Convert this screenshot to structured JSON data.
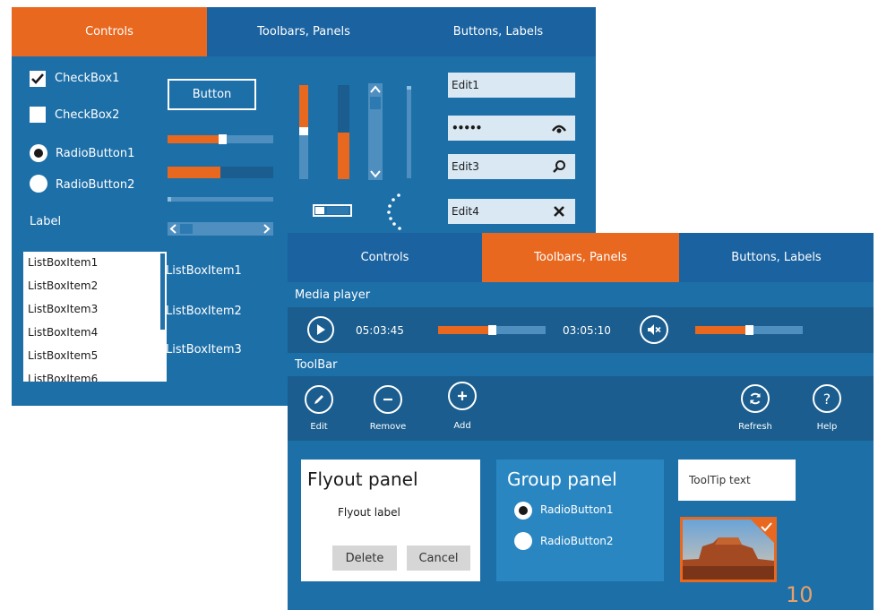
{
  "back_window": {
    "tabs": [
      {
        "label": "Controls",
        "active": true
      },
      {
        "label": "Toolbars, Panels",
        "active": false
      },
      {
        "label": "Buttons, Labels",
        "active": false
      }
    ],
    "checkbox1": {
      "label": "CheckBox1",
      "checked": true
    },
    "checkbox2": {
      "label": "CheckBox2",
      "checked": false
    },
    "radio1": {
      "label": "RadioButton1",
      "selected": true
    },
    "radio2": {
      "label": "RadioButton2",
      "selected": false
    },
    "label": "Label",
    "button_label": "Button",
    "slider1_value": 0.52,
    "progress1_value": 0.5,
    "vslider1_value": 0.45,
    "vprogress_value": 0.5,
    "edits": [
      {
        "value": "Edit1",
        "icon": "none"
      },
      {
        "value": "•••••",
        "icon": "eye-icon"
      },
      {
        "value": "Edit3",
        "icon": "search-icon"
      },
      {
        "value": "Edit4",
        "icon": "clear-icon"
      }
    ],
    "listbox_items": [
      "ListBoxItem1",
      "ListBoxItem2",
      "ListBoxItem3",
      "ListBoxItem4",
      "ListBoxItem5",
      "ListBoxItem6"
    ],
    "list_items": [
      "ListBoxItem1",
      "ListBoxItem2",
      "ListBoxItem3"
    ]
  },
  "front_window": {
    "tabs": [
      {
        "label": "Controls",
        "active": false
      },
      {
        "label": "Toolbars, Panels",
        "active": true
      },
      {
        "label": "Buttons, Labels",
        "active": false
      }
    ],
    "media_player": {
      "title": "Media player",
      "time_elapsed": "05:03:45",
      "time_total": "03:05:10",
      "position_value": 0.5,
      "volume_value": 0.5
    },
    "toolbar": {
      "title": "ToolBar",
      "edit_label": "Edit",
      "remove_label": "Remove",
      "add_label": "Add",
      "refresh_label": "Refresh",
      "help_label": "Help"
    },
    "flyout": {
      "title": "Flyout panel",
      "label": "Flyout label",
      "delete_label": "Delete",
      "cancel_label": "Cancel"
    },
    "group": {
      "title": "Group panel",
      "radio1": "RadioButton1",
      "radio2": "RadioButton2"
    },
    "tooltip_text": "ToolTip text"
  },
  "page_number": "10",
  "colors": {
    "accent": "#e8681f",
    "panel": "#1d6fa8",
    "bar": "#1a5d8e"
  }
}
